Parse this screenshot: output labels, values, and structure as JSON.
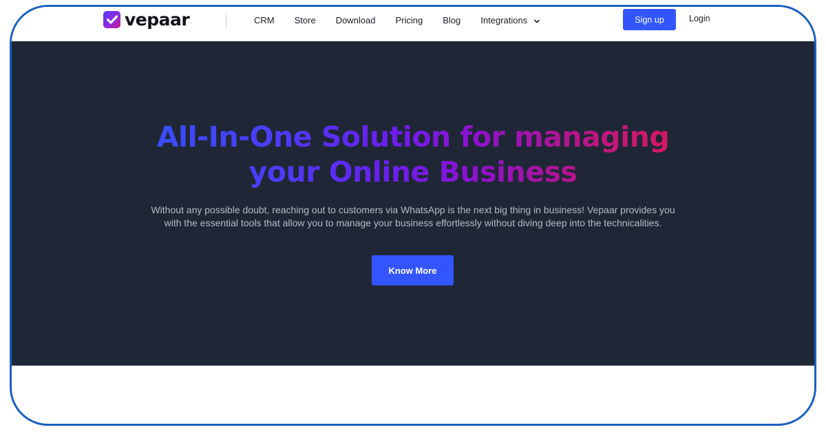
{
  "brand": {
    "name": "vepaar",
    "dot": ".",
    "logo_icon": "checkmark-square-icon",
    "gradient": [
      "#5b3cf5",
      "#8b2be0",
      "#d21b88"
    ]
  },
  "nav": {
    "items": [
      {
        "label": "CRM"
      },
      {
        "label": "Store"
      },
      {
        "label": "Download"
      },
      {
        "label": "Pricing"
      },
      {
        "label": "Blog"
      },
      {
        "label": "Integrations",
        "icon": "chevron-down-icon"
      }
    ],
    "signup_label": "Sign up",
    "login_label": "Login"
  },
  "hero": {
    "title": "All-In-One Solution for managing your Online Business",
    "description": "Without any possible doubt, reaching out to customers via WhatsApp is the next big thing in business! Vepaar provides you with the essential tools that allow you to manage your business effortlessly without diving deep into the technicalities.",
    "cta_label": "Know More"
  },
  "colors": {
    "accent": "#3355ff",
    "hero_bg": "#1f2736",
    "frame_border": "#1a5fc0",
    "title_gradient": [
      "#3a4dfb",
      "#6a1ff0",
      "#b3158e",
      "#d5195c"
    ]
  }
}
